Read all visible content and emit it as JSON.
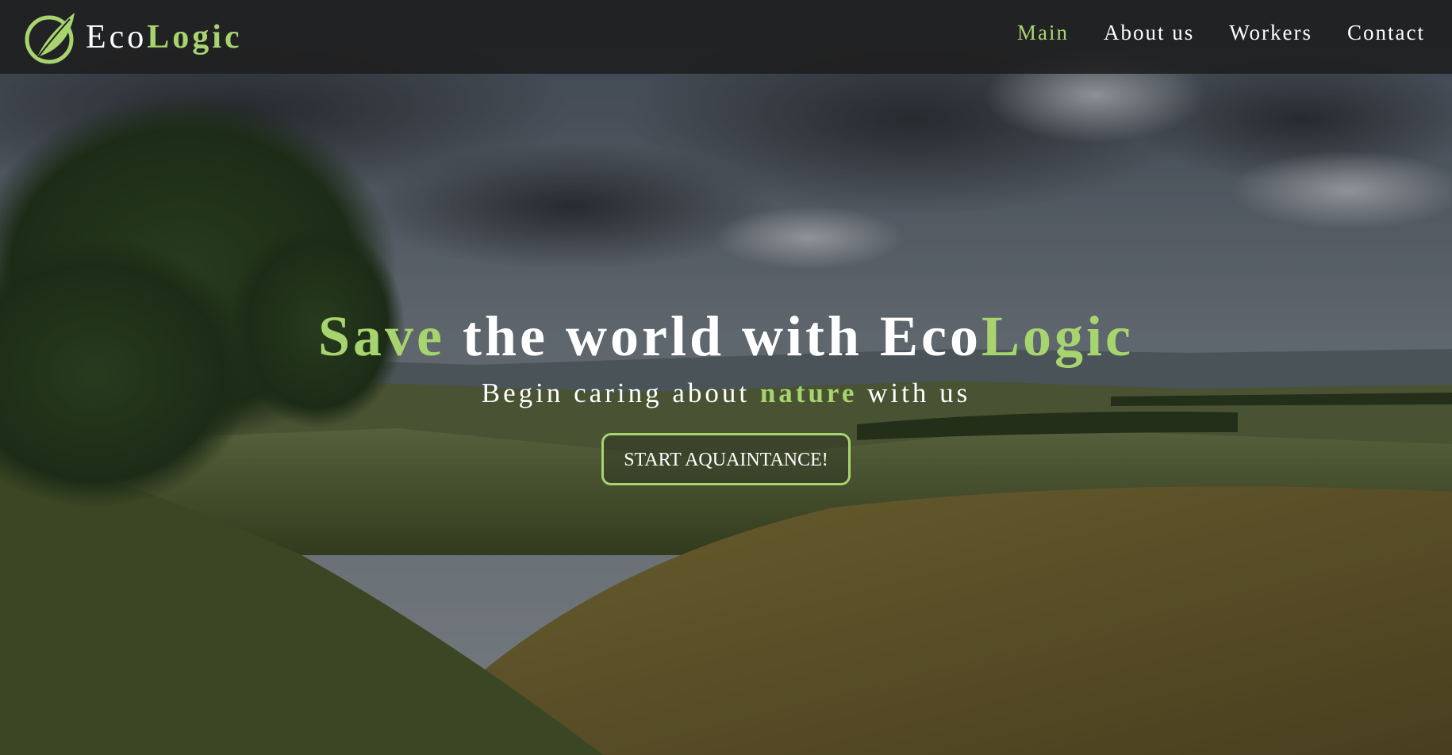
{
  "brand": {
    "name_prefix": "Eco",
    "name_accent": "Logic",
    "logo_icon": "leaf-circle-icon",
    "accent_color": "#a8d46f"
  },
  "nav": {
    "items": [
      {
        "label": "Main",
        "active": true
      },
      {
        "label": "About us",
        "active": false
      },
      {
        "label": "Workers",
        "active": false
      },
      {
        "label": "Contact",
        "active": false
      }
    ]
  },
  "hero": {
    "headline_accent": "Save",
    "headline_middle": " the world with Eco",
    "headline_brand_accent": "Logic",
    "sub_before": "Begin caring about ",
    "sub_accent": "nature",
    "sub_after": " with us",
    "cta_label": "START AQUAINTANCE!"
  }
}
